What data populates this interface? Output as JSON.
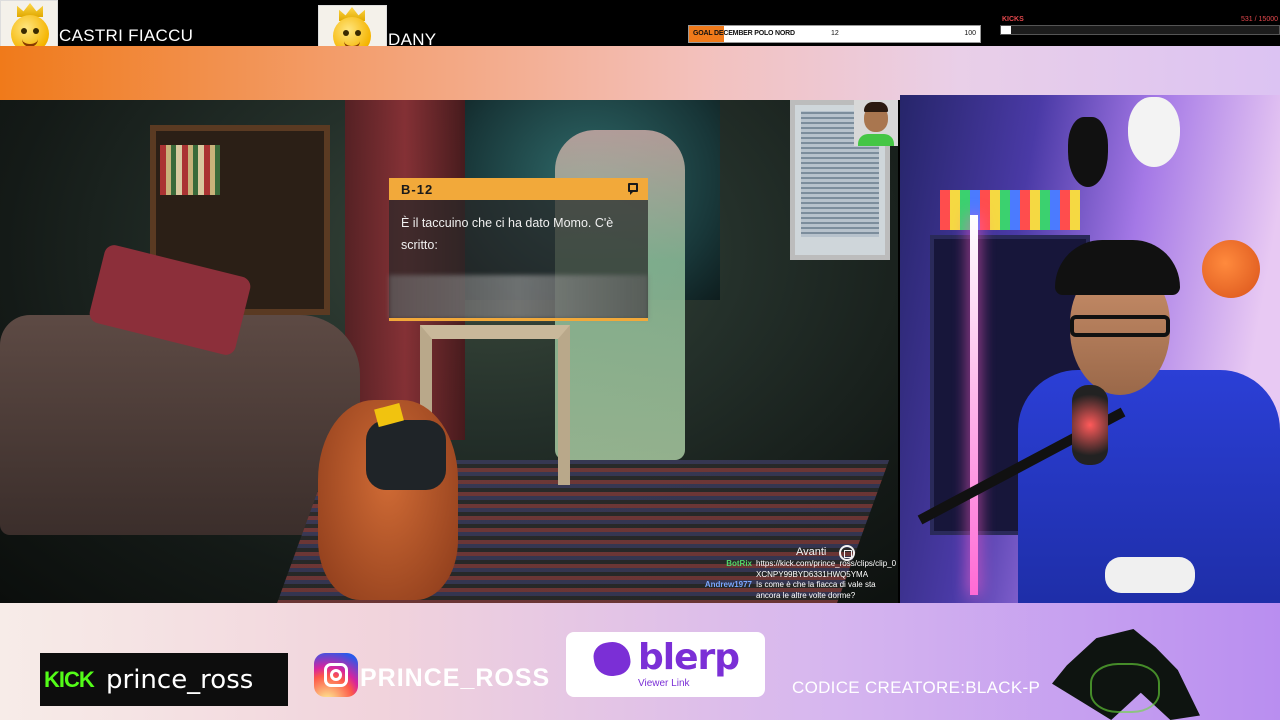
{
  "supporters": [
    {
      "name": "CASTRI FIACCU",
      "icon": "crowned-emoji-icon"
    },
    {
      "name": "DANY",
      "icon": "king-emoji-icon"
    }
  ],
  "goal": {
    "title": "GOAL DECEMBER POLO NORD",
    "current": "12",
    "target": "100",
    "progress": 0.12,
    "fill_color": "#f07a1a"
  },
  "kicks": {
    "title": "KICKS",
    "count": "531  / 15000",
    "progress": 0.035
  },
  "game": {
    "dialog": {
      "speaker": "B-12",
      "text": "È il taccuino che ci ha dato Momo. C'è scritto:",
      "accent_color": "#f2a93a"
    },
    "advance_label": "Avanti",
    "chat": [
      {
        "user": "BotRix",
        "message": "https://kick.com/prince_ross/clips/clip_0 XCNPY99BYD6331HWQ5YMA",
        "color": "#53d769"
      },
      {
        "user": "Andrew1977",
        "message": "Is come è che la fiacca di vale sta ancora le altre volte dorme?",
        "color": "#7aa7ff"
      }
    ]
  },
  "socials": {
    "kick_logo": "KICK",
    "kick_user": "prince_ross",
    "instagram_user": "PRINCE_ROSS",
    "blerp_word": "blerp",
    "blerp_sub": "Viewer Link",
    "creator_code": "CODICE CREATORE:BLACK-P"
  }
}
